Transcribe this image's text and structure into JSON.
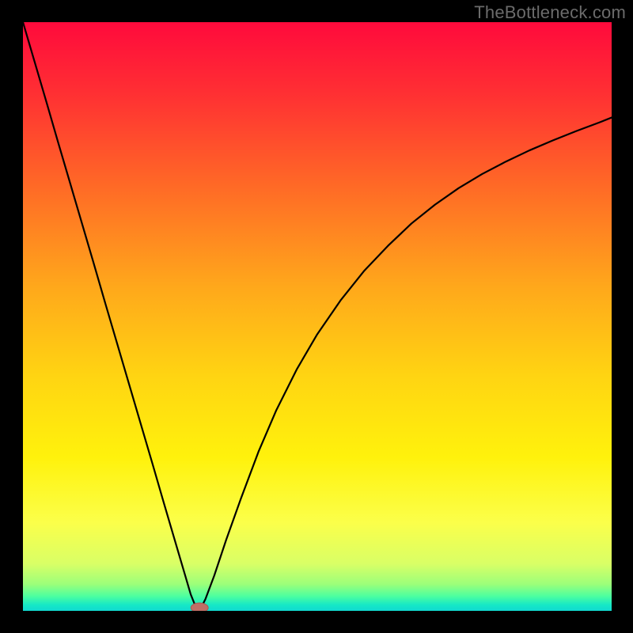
{
  "watermark": "TheBottleneck.com",
  "colors": {
    "frame": "#000000",
    "curve": "#000000",
    "marker_fill": "#bf6e66",
    "marker_stroke": "#a85a52",
    "gradient_stops": [
      {
        "offset": 0.0,
        "color": "#ff0a3c"
      },
      {
        "offset": 0.12,
        "color": "#ff2f33"
      },
      {
        "offset": 0.28,
        "color": "#ff6a26"
      },
      {
        "offset": 0.45,
        "color": "#ffa81b"
      },
      {
        "offset": 0.6,
        "color": "#ffd412"
      },
      {
        "offset": 0.74,
        "color": "#fff20c"
      },
      {
        "offset": 0.85,
        "color": "#fbff4a"
      },
      {
        "offset": 0.92,
        "color": "#d9ff66"
      },
      {
        "offset": 0.955,
        "color": "#9bff7a"
      },
      {
        "offset": 0.975,
        "color": "#4dffa0"
      },
      {
        "offset": 0.99,
        "color": "#16e8c6"
      },
      {
        "offset": 1.0,
        "color": "#11d9d0"
      }
    ]
  },
  "chart_data": {
    "type": "line",
    "title": "",
    "xlabel": "",
    "ylabel": "",
    "xlim": [
      0,
      1
    ],
    "ylim": [
      0,
      1
    ],
    "grid": false,
    "x": [
      0.0,
      0.02,
      0.04,
      0.06,
      0.08,
      0.1,
      0.12,
      0.14,
      0.16,
      0.18,
      0.2,
      0.22,
      0.24,
      0.26,
      0.275,
      0.285,
      0.293,
      0.3,
      0.31,
      0.325,
      0.345,
      0.37,
      0.4,
      0.43,
      0.465,
      0.5,
      0.54,
      0.58,
      0.62,
      0.66,
      0.7,
      0.74,
      0.78,
      0.82,
      0.86,
      0.9,
      0.94,
      0.98,
      1.0
    ],
    "y": [
      1.0,
      0.932,
      0.864,
      0.795,
      0.727,
      0.659,
      0.591,
      0.522,
      0.454,
      0.386,
      0.318,
      0.25,
      0.181,
      0.113,
      0.062,
      0.028,
      0.008,
      0.0,
      0.02,
      0.06,
      0.12,
      0.19,
      0.27,
      0.34,
      0.41,
      0.47,
      0.528,
      0.578,
      0.62,
      0.658,
      0.69,
      0.718,
      0.742,
      0.763,
      0.782,
      0.799,
      0.815,
      0.83,
      0.838
    ],
    "minimum_marker": {
      "x": 0.3,
      "y": 0.0
    }
  }
}
